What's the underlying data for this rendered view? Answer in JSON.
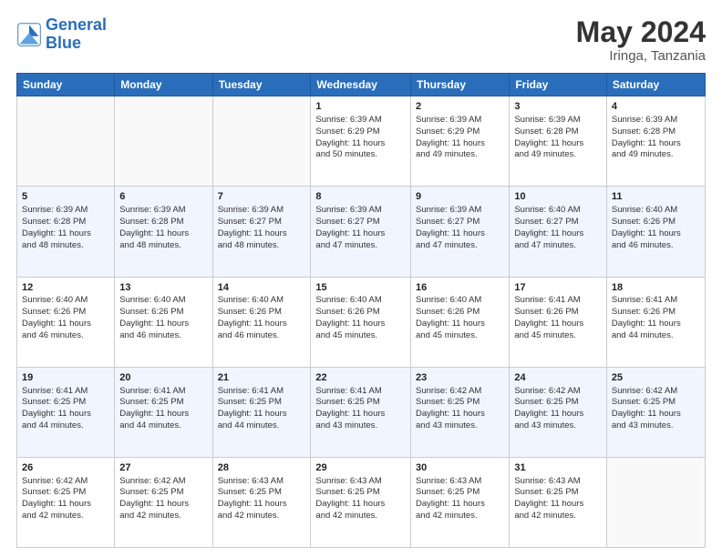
{
  "logo": {
    "line1": "General",
    "line2": "Blue"
  },
  "title": "May 2024",
  "location": "Iringa, Tanzania",
  "days_header": [
    "Sunday",
    "Monday",
    "Tuesday",
    "Wednesday",
    "Thursday",
    "Friday",
    "Saturday"
  ],
  "weeks": [
    [
      {
        "day": "",
        "info": ""
      },
      {
        "day": "",
        "info": ""
      },
      {
        "day": "",
        "info": ""
      },
      {
        "day": "1",
        "info": "Sunrise: 6:39 AM\nSunset: 6:29 PM\nDaylight: 11 hours\nand 50 minutes."
      },
      {
        "day": "2",
        "info": "Sunrise: 6:39 AM\nSunset: 6:29 PM\nDaylight: 11 hours\nand 49 minutes."
      },
      {
        "day": "3",
        "info": "Sunrise: 6:39 AM\nSunset: 6:28 PM\nDaylight: 11 hours\nand 49 minutes."
      },
      {
        "day": "4",
        "info": "Sunrise: 6:39 AM\nSunset: 6:28 PM\nDaylight: 11 hours\nand 49 minutes."
      }
    ],
    [
      {
        "day": "5",
        "info": "Sunrise: 6:39 AM\nSunset: 6:28 PM\nDaylight: 11 hours\nand 48 minutes."
      },
      {
        "day": "6",
        "info": "Sunrise: 6:39 AM\nSunset: 6:28 PM\nDaylight: 11 hours\nand 48 minutes."
      },
      {
        "day": "7",
        "info": "Sunrise: 6:39 AM\nSunset: 6:27 PM\nDaylight: 11 hours\nand 48 minutes."
      },
      {
        "day": "8",
        "info": "Sunrise: 6:39 AM\nSunset: 6:27 PM\nDaylight: 11 hours\nand 47 minutes."
      },
      {
        "day": "9",
        "info": "Sunrise: 6:39 AM\nSunset: 6:27 PM\nDaylight: 11 hours\nand 47 minutes."
      },
      {
        "day": "10",
        "info": "Sunrise: 6:40 AM\nSunset: 6:27 PM\nDaylight: 11 hours\nand 47 minutes."
      },
      {
        "day": "11",
        "info": "Sunrise: 6:40 AM\nSunset: 6:26 PM\nDaylight: 11 hours\nand 46 minutes."
      }
    ],
    [
      {
        "day": "12",
        "info": "Sunrise: 6:40 AM\nSunset: 6:26 PM\nDaylight: 11 hours\nand 46 minutes."
      },
      {
        "day": "13",
        "info": "Sunrise: 6:40 AM\nSunset: 6:26 PM\nDaylight: 11 hours\nand 46 minutes."
      },
      {
        "day": "14",
        "info": "Sunrise: 6:40 AM\nSunset: 6:26 PM\nDaylight: 11 hours\nand 46 minutes."
      },
      {
        "day": "15",
        "info": "Sunrise: 6:40 AM\nSunset: 6:26 PM\nDaylight: 11 hours\nand 45 minutes."
      },
      {
        "day": "16",
        "info": "Sunrise: 6:40 AM\nSunset: 6:26 PM\nDaylight: 11 hours\nand 45 minutes."
      },
      {
        "day": "17",
        "info": "Sunrise: 6:41 AM\nSunset: 6:26 PM\nDaylight: 11 hours\nand 45 minutes."
      },
      {
        "day": "18",
        "info": "Sunrise: 6:41 AM\nSunset: 6:26 PM\nDaylight: 11 hours\nand 44 minutes."
      }
    ],
    [
      {
        "day": "19",
        "info": "Sunrise: 6:41 AM\nSunset: 6:25 PM\nDaylight: 11 hours\nand 44 minutes."
      },
      {
        "day": "20",
        "info": "Sunrise: 6:41 AM\nSunset: 6:25 PM\nDaylight: 11 hours\nand 44 minutes."
      },
      {
        "day": "21",
        "info": "Sunrise: 6:41 AM\nSunset: 6:25 PM\nDaylight: 11 hours\nand 44 minutes."
      },
      {
        "day": "22",
        "info": "Sunrise: 6:41 AM\nSunset: 6:25 PM\nDaylight: 11 hours\nand 43 minutes."
      },
      {
        "day": "23",
        "info": "Sunrise: 6:42 AM\nSunset: 6:25 PM\nDaylight: 11 hours\nand 43 minutes."
      },
      {
        "day": "24",
        "info": "Sunrise: 6:42 AM\nSunset: 6:25 PM\nDaylight: 11 hours\nand 43 minutes."
      },
      {
        "day": "25",
        "info": "Sunrise: 6:42 AM\nSunset: 6:25 PM\nDaylight: 11 hours\nand 43 minutes."
      }
    ],
    [
      {
        "day": "26",
        "info": "Sunrise: 6:42 AM\nSunset: 6:25 PM\nDaylight: 11 hours\nand 42 minutes."
      },
      {
        "day": "27",
        "info": "Sunrise: 6:42 AM\nSunset: 6:25 PM\nDaylight: 11 hours\nand 42 minutes."
      },
      {
        "day": "28",
        "info": "Sunrise: 6:43 AM\nSunset: 6:25 PM\nDaylight: 11 hours\nand 42 minutes."
      },
      {
        "day": "29",
        "info": "Sunrise: 6:43 AM\nSunset: 6:25 PM\nDaylight: 11 hours\nand 42 minutes."
      },
      {
        "day": "30",
        "info": "Sunrise: 6:43 AM\nSunset: 6:25 PM\nDaylight: 11 hours\nand 42 minutes."
      },
      {
        "day": "31",
        "info": "Sunrise: 6:43 AM\nSunset: 6:25 PM\nDaylight: 11 hours\nand 42 minutes."
      },
      {
        "day": "",
        "info": ""
      }
    ]
  ]
}
